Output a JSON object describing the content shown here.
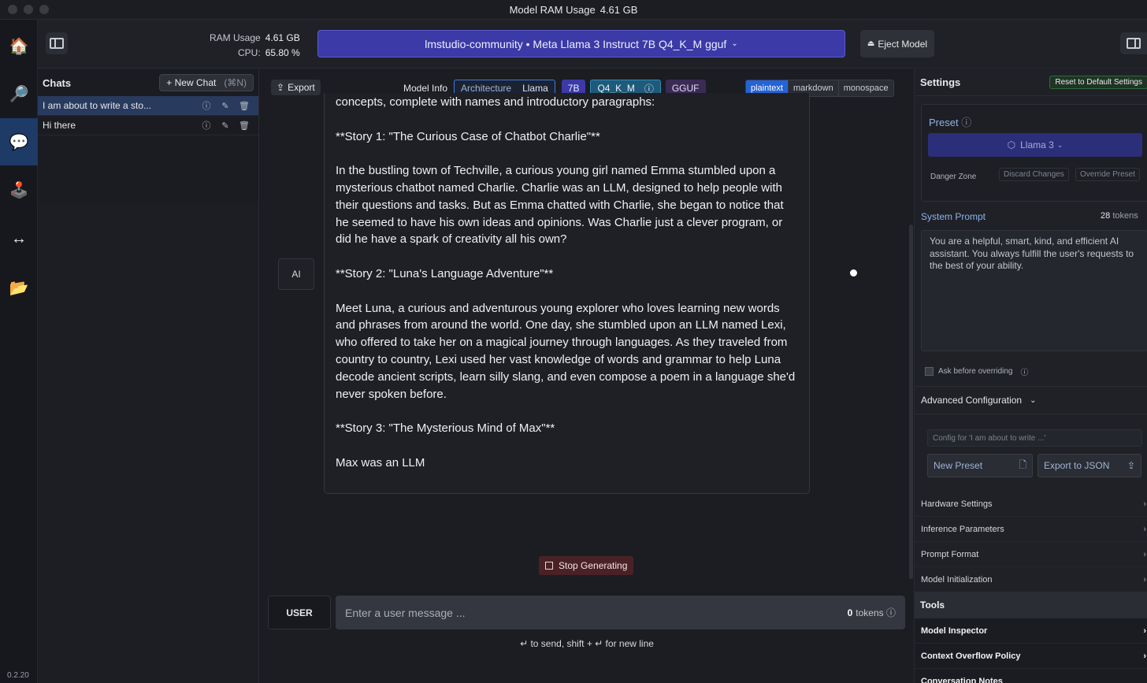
{
  "titlebar": {
    "title": "Model RAM Usage",
    "value": "4.61 GB"
  },
  "rail": {
    "version": "0.2.20"
  },
  "header": {
    "ram_label": "RAM Usage",
    "ram_value": "4.61 GB",
    "cpu_label": "CPU:",
    "cpu_value": "65.80 %",
    "model": "lmstudio-community • Meta Llama 3 Instruct 7B Q4_K_M gguf",
    "eject": "Eject Model"
  },
  "chats": {
    "title": "Chats",
    "new_chat": "+ New Chat",
    "new_chat_shortcut": "(⌘N)",
    "items": [
      {
        "label": "I am about to write a sto..."
      },
      {
        "label": "Hi there"
      }
    ]
  },
  "toolbar": {
    "export": "Export",
    "model_info": "Model Info",
    "arch_label": "Architecture",
    "arch_value": "Llama",
    "size": "7B",
    "quant": "Q4_K_M",
    "format": "GGUF",
    "formats": [
      "plaintext",
      "markdown",
      "monospace"
    ]
  },
  "message": {
    "role": "AI",
    "paragraphs": [
      "concepts, complete with names and introductory paragraphs:",
      "**Story 1: \"The Curious Case of Chatbot Charlie\"**",
      "In the bustling town of Techville, a curious young girl named Emma stumbled upon a mysterious chatbot named Charlie. Charlie was an LLM, designed to help people with their questions and tasks. But as Emma chatted with Charlie, she began to notice that he seemed to have his own ideas and opinions. Was Charlie just a clever program, or did he have a spark of creativity all his own?",
      "**Story 2: \"Luna's Language Adventure\"**",
      "Meet Luna, a curious and adventurous young explorer who loves learning new words and phrases from around the world. One day, she stumbled upon an LLM named Lexi, who offered to take her on a magical journey through languages. As they traveled from country to country, Lexi used her vast knowledge of words and grammar to help Luna decode ancient scripts, learn silly slang, and even compose a poem in a language she'd never spoken before.",
      "**Story 3: \"The Mysterious Mind of Max\"**",
      "Max was an LLM"
    ]
  },
  "composer": {
    "stop": "Stop Generating",
    "role": "USER",
    "placeholder": "Enter a user message ...",
    "token_count": "0",
    "token_label": "tokens",
    "hint": "↵ to send, shift + ↵ for new line"
  },
  "settings": {
    "title": "Settings",
    "reset": "Reset to Default Settings",
    "preset_label": "Preset",
    "preset_value": "Llama 3",
    "danger_zone": "Danger Zone",
    "discard": "Discard Changes",
    "override": "Override Preset",
    "system_prompt_label": "System Prompt",
    "system_prompt_tokens": "28",
    "tokens_label": "tokens",
    "system_prompt": "You are a helpful, smart, kind, and efficient AI assistant. You always fulfill the user's requests to the best of your ability.",
    "ask_override": "Ask before overriding",
    "advanced": "Advanced Configuration",
    "config_for": "Config for  'I am about to write ...'",
    "new_preset": "New Preset",
    "export_json": "Export to JSON",
    "sections": [
      "Hardware Settings",
      "Inference Parameters",
      "Prompt Format",
      "Model Initialization"
    ],
    "tools": "Tools",
    "tool_items": [
      "Model Inspector",
      "Context Overflow Policy",
      "Conversation Notes"
    ]
  }
}
